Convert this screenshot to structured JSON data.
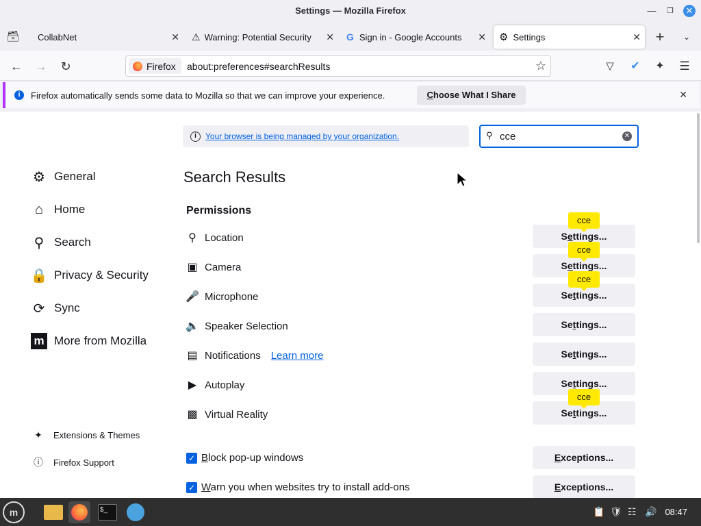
{
  "window": {
    "title": "Settings — Mozilla Firefox"
  },
  "tabs": [
    {
      "label": "CollabNet"
    },
    {
      "label": "Warning: Potential Security"
    },
    {
      "label": "Sign in - Google Accounts"
    },
    {
      "label": "Settings"
    }
  ],
  "urlbar": {
    "identity": "Firefox",
    "url": "about:preferences#searchResults"
  },
  "infobar": {
    "text": "Firefox automatically sends some data to Mozilla so that we can improve your experience.",
    "button": {
      "before": "",
      "key": "C",
      "after": "hoose What I Share"
    }
  },
  "managed": {
    "text": "Your browser is being managed by your organization."
  },
  "search": {
    "value": "cce"
  },
  "sidebar": {
    "items": [
      {
        "label": "General"
      },
      {
        "label": "Home"
      },
      {
        "label": "Search"
      },
      {
        "label": "Privacy & Security"
      },
      {
        "label": "Sync"
      },
      {
        "label": "More from Mozilla"
      }
    ],
    "footer": [
      {
        "label": "Extensions & Themes"
      },
      {
        "label": "Firefox Support"
      }
    ]
  },
  "main": {
    "heading": "Search Results",
    "section": "Permissions",
    "permissions": [
      {
        "label": "Location",
        "button": {
          "before": "S",
          "key": "e",
          "after": "ttings..."
        },
        "tip": "cce"
      },
      {
        "label": "Camera",
        "button": {
          "before": "S",
          "key": "e",
          "after": "ttings..."
        },
        "tip": "cce"
      },
      {
        "label": "Microphone",
        "button": {
          "before": "Se",
          "key": "t",
          "after": "tings..."
        },
        "tip": "cce"
      },
      {
        "label": "Speaker Selection",
        "button": {
          "before": "Se",
          "key": "t",
          "after": "tings..."
        },
        "tip": ""
      },
      {
        "label": "Notifications",
        "link": "Learn more",
        "button": {
          "before": "Se",
          "key": "t",
          "after": "tings..."
        },
        "tip": ""
      },
      {
        "label": "Autoplay",
        "button": {
          "before": "Se",
          "key": "t",
          "after": "tings..."
        },
        "tip": ""
      },
      {
        "label": "Virtual Reality",
        "button": {
          "before": "Se",
          "key": "t",
          "after": "tings..."
        },
        "tip": "cce"
      }
    ],
    "checks": [
      {
        "before": "",
        "key": "B",
        "after": "lock pop-up windows",
        "checked": true,
        "button": {
          "before": "",
          "key": "E",
          "after": "xceptions..."
        }
      },
      {
        "before": "",
        "key": "W",
        "after": "arn you when websites try to install add-ons",
        "checked": true,
        "button": {
          "before": "",
          "key": "E",
          "after": "xceptions..."
        }
      }
    ]
  },
  "taskbar": {
    "clock": "08:47"
  },
  "colors": {
    "accent": "#0061e0",
    "tooltip": "#ffe900",
    "infobar_border": "#b133ff"
  }
}
